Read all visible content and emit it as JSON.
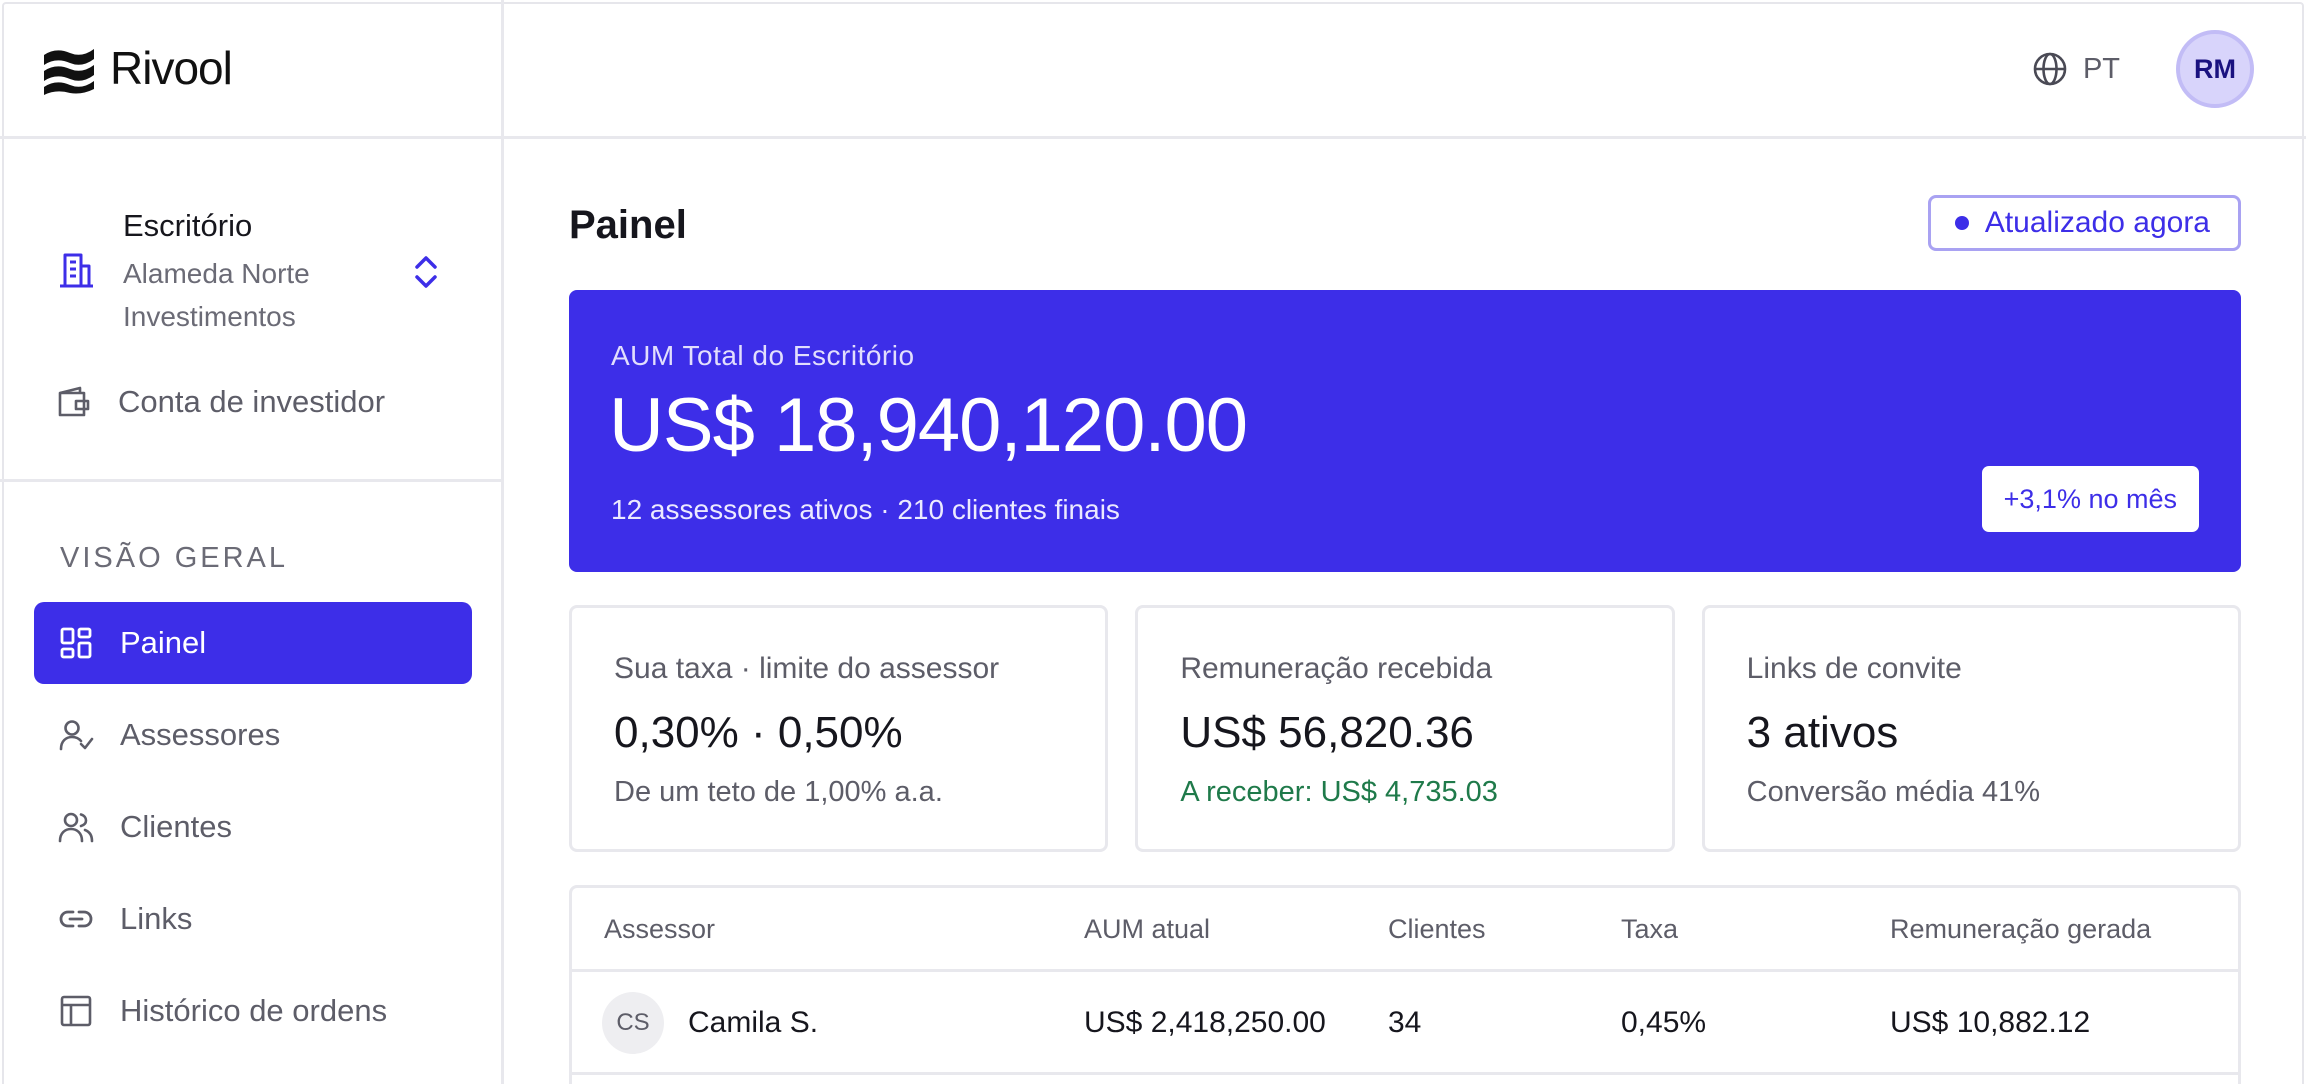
{
  "app": {
    "name": "Rivool"
  },
  "sidebar": {
    "org": {
      "label": "Escritório",
      "name": "Alameda Norte Investimentos"
    },
    "investor_link": "Conta de investidor",
    "section_title": "VISÃO GERAL",
    "items": [
      {
        "label": "Painel",
        "icon": "dashboard-icon",
        "active": true
      },
      {
        "label": "Assessores",
        "icon": "user-check-icon"
      },
      {
        "label": "Clientes",
        "icon": "users-icon"
      },
      {
        "label": "Links",
        "icon": "link-icon"
      },
      {
        "label": "Histórico de ordens",
        "icon": "table-icon"
      }
    ]
  },
  "topbar": {
    "language": "PT",
    "avatar_initials": "RM"
  },
  "main": {
    "title": "Painel",
    "status": "Atualizado agora",
    "hero": {
      "label": "AUM Total do Escritório",
      "value": "US$ 18,940,120.00",
      "sub": "12 assessores ativos · 210 clientes finais",
      "badge": "+3,1% no mês"
    },
    "stats": [
      {
        "label": "Sua taxa · limite do assessor",
        "value": "0,30% · 0,50%",
        "sub": "De um teto de 1,00% a.a."
      },
      {
        "label": "Remuneração recebida",
        "value": "US$ 56,820.36",
        "sub": "A receber: US$ 4,735.03"
      },
      {
        "label": "Links de convite",
        "value": "3 ativos",
        "sub": "Conversão média 41%"
      }
    ],
    "table": {
      "headers": [
        "Assessor",
        "AUM atual",
        "Clientes",
        "Taxa",
        "Remuneração gerada"
      ],
      "rows": [
        {
          "initials": "CS",
          "name": "Camila S.",
          "aum": "US$ 2,418,250.00",
          "clients": "34",
          "rate": "0,45%",
          "earned": "US$ 10,882.12"
        }
      ]
    }
  },
  "colors": {
    "accent": "#3d2ee8",
    "positive": "#1f7a4a",
    "border": "#e8e8ed"
  }
}
